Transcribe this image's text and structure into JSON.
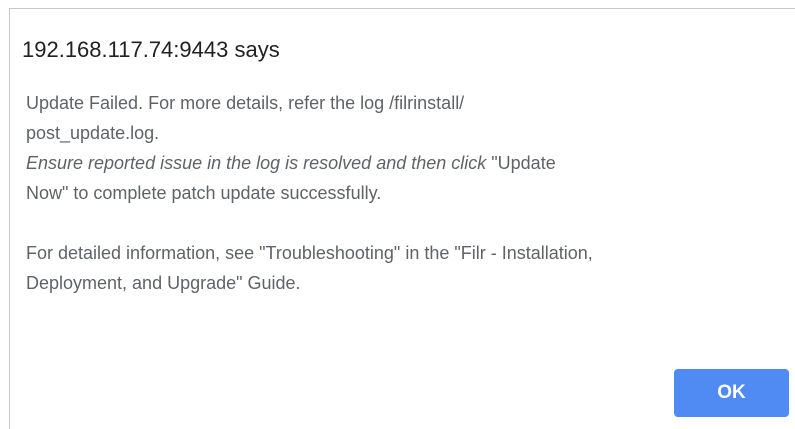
{
  "dialog": {
    "title": "192.168.117.74:9443 says",
    "message": {
      "line1": "Update Failed. For more details, refer the log /filrinstall/",
      "line2": "post_update.log.",
      "line3_italic": "Ensure reported issue in the log is resolved and then click",
      "line3_rest": " \"Update",
      "line4": "Now\" to complete patch update successfully.",
      "line5": "For detailed information, see \"Troubleshooting\" in the \"Filr - Installation,",
      "line6": "Deployment, and Upgrade\" Guide."
    },
    "ok_label": "OK"
  },
  "colors": {
    "title_text": "#202124",
    "body_text": "#5f6368",
    "button_bg": "#4f8bf2",
    "button_text": "#ffffff"
  }
}
